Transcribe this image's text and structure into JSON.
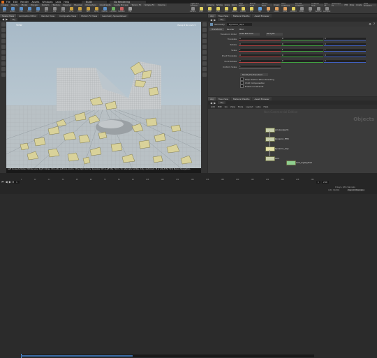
{
  "menubar": {
    "items": [
      "File",
      "Edit",
      "Render",
      "Assets",
      "Windows",
      "Labs",
      "Help"
    ],
    "workspace": "Build",
    "desktop": "No Rendering"
  },
  "shelf": {
    "tabs": [
      "Create",
      "Modify",
      "Model",
      "Polygon",
      "Deform",
      "Texture",
      "Rigging",
      "Muscles",
      "Characters",
      "Constraints",
      "Guide Process",
      "Terrain FX",
      "Simple FX",
      "Volume"
    ],
    "tools": [
      {
        "label": "Box",
        "color": "#5a8fc8"
      },
      {
        "label": "Sphere",
        "color": "#5a8fc8"
      },
      {
        "label": "Tube",
        "color": "#5a8fc8"
      },
      {
        "label": "Torus",
        "color": "#5a8fc8"
      },
      {
        "label": "Grid",
        "color": "#5a8fc8"
      },
      {
        "label": "Null",
        "color": "#8a8a8a"
      },
      {
        "label": "Line",
        "color": "#8a8a8a"
      },
      {
        "label": "Circle",
        "color": "#8a8a8a"
      },
      {
        "label": "Curve",
        "color": "#c8a040"
      },
      {
        "label": "Draw",
        "color": "#c8a040"
      },
      {
        "label": "Path",
        "color": "#c8a040"
      },
      {
        "label": "Spray",
        "color": "#c8a040"
      },
      {
        "label": "Platonic",
        "color": "#5a8fc8"
      },
      {
        "label": "L-System",
        "color": "#6ab060"
      },
      {
        "label": "Metaball",
        "color": "#c86060"
      },
      {
        "label": "File",
        "color": "#a0a0a0"
      }
    ],
    "tools_right": [
      {
        "label": "Camera",
        "color": "#8a8a8a"
      },
      {
        "label": "Point",
        "color": "#e0d060"
      },
      {
        "label": "Spot",
        "color": "#e0d060"
      },
      {
        "label": "Area",
        "color": "#e0d060"
      },
      {
        "label": "Geo",
        "color": "#e0d060"
      },
      {
        "label": "Volume",
        "color": "#e0d060"
      },
      {
        "label": "Distant",
        "color": "#e0d060"
      },
      {
        "label": "Env",
        "color": "#e0d060"
      },
      {
        "label": "Sky",
        "color": "#60a0e0"
      },
      {
        "label": "GI",
        "color": "#e0a060"
      },
      {
        "label": "Caustic",
        "color": "#e0a060"
      },
      {
        "label": "Portal",
        "color": "#e0a060"
      },
      {
        "label": "Ambient",
        "color": "#e0d060"
      },
      {
        "label": "Stereo",
        "color": "#8a8a8a"
      },
      {
        "label": "VR",
        "color": "#8a8a8a"
      },
      {
        "label": "Switcher",
        "color": "#8a8a8a"
      },
      {
        "label": "Gamepad",
        "color": "#8a8a8a"
      }
    ],
    "right_tabs": [
      "Lights and Cameras",
      "Collisions",
      "Particles",
      "Grains",
      "Vellum",
      "Rigid Bodies",
      "Particle Fluids",
      "Viscous Fluids",
      "Oceans",
      "Fluid Containers",
      "Populate Containers",
      "Container Tools",
      "Pyro FX",
      "Sparse Pyro FX",
      "FEM",
      "Wires",
      "Crowds",
      "Drive Simulation"
    ]
  },
  "viewport": {
    "tabs": [
      "Scene View",
      "Animation Editor",
      "Render View",
      "Composite View",
      "Motion FX View",
      "Geometry Spreadsheet"
    ],
    "path_label": "obj",
    "view_label": "View",
    "camera_label": "Persp ▾  No cam ▾",
    "status": "Left mouse tumbles. Middle pans. Right dollies. Ctrl+Alt+Left box-zooms. Ctrl+Right zooms. Spacebar Ctrl+Left tilts. Hold L for alternate tumble, dolly, and zoom.   M or Alt+M for First Person Navigation."
  },
  "timeline": {
    "start": "1",
    "end": "240",
    "current": "1",
    "ticks": [
      "1",
      "12",
      "24",
      "36",
      "48",
      "60",
      "72",
      "84",
      "96",
      "108",
      "120",
      "132",
      "144",
      "156",
      "168",
      "180",
      "192",
      "204",
      "216",
      "228",
      "240"
    ],
    "range_start": "1",
    "range_end": "240",
    "auto_update": "Auto Update",
    "keys_label": "0 keys, 0/0 channels",
    "key_all": "Key All Channels"
  },
  "params": {
    "tabs": [
      "Tree View",
      "Material Palette",
      "Asset Browser",
      "obj"
    ],
    "path": "obj",
    "node_type": "Geometry",
    "node_name": "Dynamic_obj1",
    "sub_tabs": [
      "Transform",
      "Render",
      "Misc"
    ],
    "xform_order_label": "Transform Order",
    "xform_order_value": "Scale Rot Trans",
    "rot_order_value": "Rx Ry Rz",
    "rows": [
      {
        "label": "Translate",
        "values": [
          "0",
          "0",
          "0"
        ]
      },
      {
        "label": "Rotate",
        "values": [
          "0",
          "0",
          "0"
        ]
      },
      {
        "label": "Scale",
        "values": [
          "1",
          "1",
          "1"
        ]
      },
      {
        "label": "Pivot Translate",
        "values": [
          "0",
          "0",
          "0"
        ]
      },
      {
        "label": "Pivot Rotate",
        "values": [
          "0",
          "0",
          "0"
        ]
      },
      {
        "label": "Uniform Scale",
        "values": [
          "1"
        ]
      }
    ],
    "modify_pre": "Modify Pre-Transform",
    "checks": [
      "Keep Position When Parenting",
      "Child Compensation",
      "Enable Constraints"
    ]
  },
  "network": {
    "tabs": [
      "Tree View",
      "Material Palette",
      "Asset Browser"
    ],
    "path": "obj",
    "menu": [
      "Add",
      "Edit",
      "Go",
      "View",
      "Tools",
      "Layout",
      "Labs",
      "Help"
    ],
    "watermark_left": "Non-Commercial Edition",
    "watermark_right": "Objects",
    "nodes": [
      {
        "label": "smokeobject1"
      },
      {
        "label": "Dynamic_FEM"
      },
      {
        "label": "Dynamic_obj1"
      },
      {
        "label": "Grid"
      },
      {
        "label": "Grid_highlighted"
      }
    ]
  }
}
